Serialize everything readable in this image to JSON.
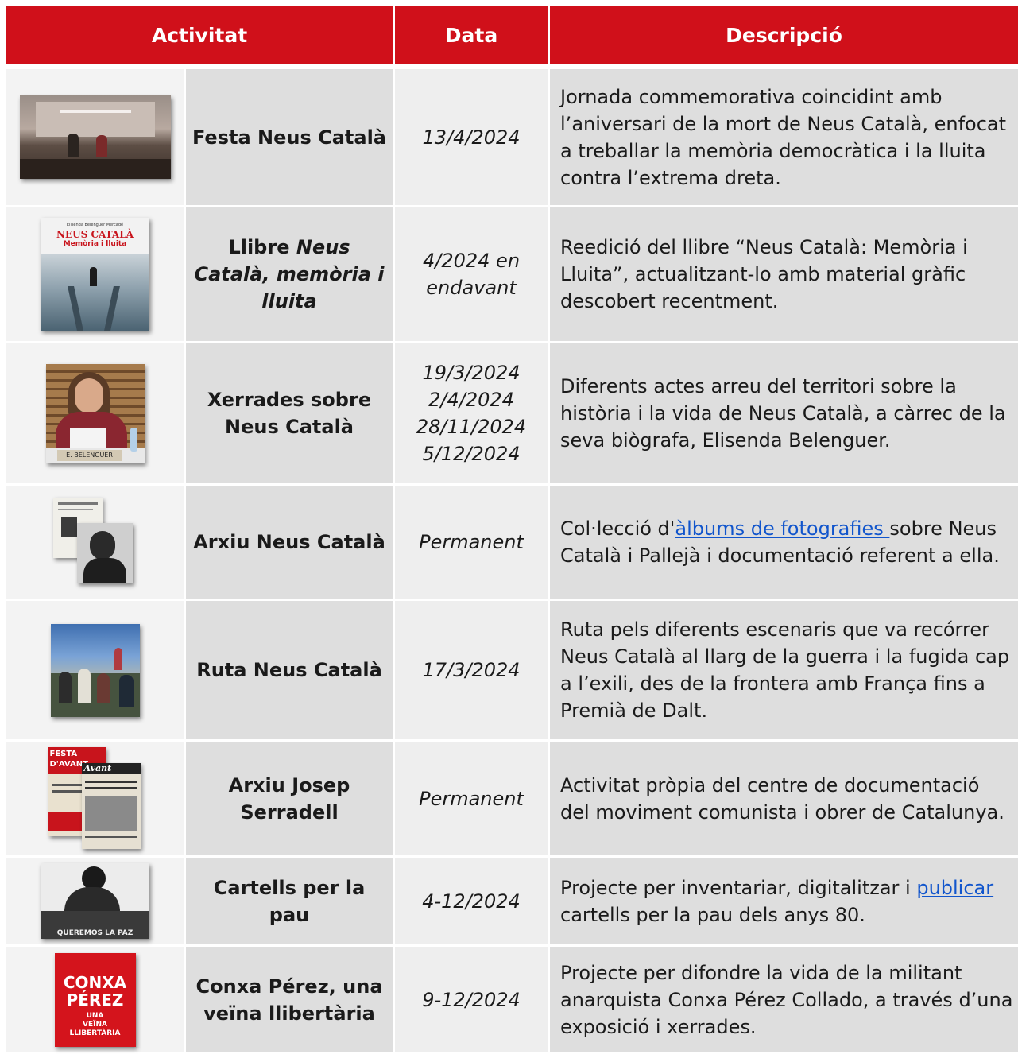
{
  "header": {
    "col_activity": "Activitat",
    "col_date": "Data",
    "col_description": "Descripció"
  },
  "rows": [
    {
      "activity": "Festa Neus Català",
      "date": "13/4/2024",
      "description": "Jornada commemorativa coincidint amb l’aniversari de la mort de Neus Català, enfocat a treballar la memòria democràtica i la lluita contra l’extrema dreta."
    },
    {
      "activity_prefix": "Llibre ",
      "activity_italic": "Neus Català, memòria i lluita",
      "date": "4/2024 en endavant",
      "description": "Reedició del llibre “Neus Català: Memòria i Lluita”, actualitzant-lo amb material gràfic descobert recentment.",
      "cover_author": "Elisenda Belenguer Mercadé",
      "cover_title": "Neus Català",
      "cover_subtitle": "Memòria i lluita"
    },
    {
      "activity": "Xerrades sobre Neus Català",
      "date_1": "19/3/2024",
      "date_2": "2/4/2024",
      "date_3": "28/11/2024",
      "date_4": "5/12/2024",
      "description": "Diferents actes arreu del territori sobre la història i la vida de Neus Català, a càrrec de la seva biògrafa, Elisenda Belenguer.",
      "nameplate": "E. BELENGUER"
    },
    {
      "activity": "Arxiu Neus Català",
      "date": "Permanent",
      "description_before": "Col·lecció d'",
      "description_link": "àlbums de fotografies ",
      "description_after": "sobre Neus Català i Pallejà i documentació referent a ella."
    },
    {
      "activity": "Ruta Neus Català",
      "date": "17/3/2024",
      "description": "Ruta pels diferents escenaris que va recórrer Neus Català al llarg de la guerra i la fugida cap a l’exili, des de la frontera amb França fins a Premià de Dalt."
    },
    {
      "activity": "Arxiu Josep Serradell",
      "date": "Permanent",
      "description": "Activitat pròpia del centre de documentació del moviment comunista i obrer de Catalunya.",
      "poster_title": "FESTA D'AVANT",
      "newspaper_title": "Avant"
    },
    {
      "activity": "Cartells per la pau",
      "date": "4-12/2024",
      "description_before": "Projecte per inventariar, digitalitzar i ",
      "description_link": "publicar",
      "description_after": " cartells per la pau dels anys 80.",
      "poster_caption": "QUEREMOS LA PAZ"
    },
    {
      "activity": "Conxa Pérez, una veïna llibertària",
      "date": "9-12/2024",
      "description": "Projecte per difondre la vida de la militant anarquista Conxa Pérez Collado, a través d’una exposició i xerrades.",
      "cover_line1": "CONXA",
      "cover_line2": "PÉREZ",
      "cover_line3": "UNA",
      "cover_line4": "VEÏNA",
      "cover_line5": "LLIBERTÀRIA"
    }
  ],
  "colors": {
    "header_bg": "#d0101a",
    "link": "#1155cc"
  }
}
